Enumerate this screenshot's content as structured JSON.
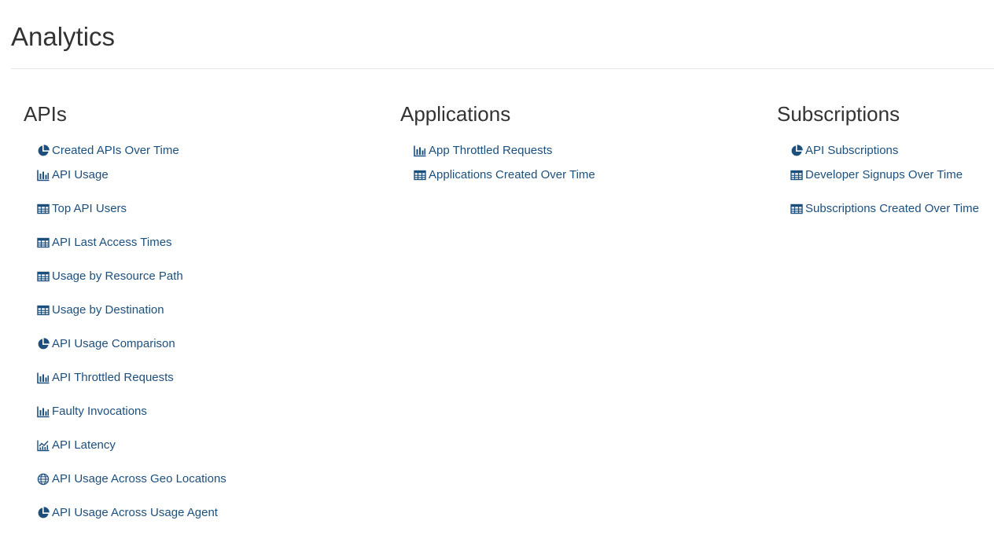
{
  "page": {
    "title": "Analytics"
  },
  "sections": {
    "apis": {
      "heading": "APIs",
      "items": [
        {
          "label": "Created APIs Over Time",
          "icon": "pie-chart-icon"
        },
        {
          "label": "API Usage",
          "icon": "bar-chart-icon"
        },
        {
          "label": "Top API Users",
          "icon": "table-icon"
        },
        {
          "label": "API Last Access Times",
          "icon": "table-icon"
        },
        {
          "label": "Usage by Resource Path",
          "icon": "table-icon"
        },
        {
          "label": "Usage by Destination",
          "icon": "table-icon"
        },
        {
          "label": "API Usage Comparison",
          "icon": "pie-chart-icon"
        },
        {
          "label": "API Throttled Requests",
          "icon": "bar-chart-icon"
        },
        {
          "label": "Faulty Invocations",
          "icon": "bar-chart-icon"
        },
        {
          "label": "API Latency",
          "icon": "line-chart-icon"
        },
        {
          "label": "API Usage Across Geo Locations",
          "icon": "globe-icon"
        },
        {
          "label": "API Usage Across Usage Agent",
          "icon": "pie-chart-icon"
        }
      ]
    },
    "applications": {
      "heading": "Applications",
      "items": [
        {
          "label": "App Throttled Requests",
          "icon": "bar-chart-icon"
        },
        {
          "label": "Applications Created Over Time",
          "icon": "table-icon"
        }
      ]
    },
    "subscriptions": {
      "heading": "Subscriptions",
      "items": [
        {
          "label": "API Subscriptions",
          "icon": "pie-chart-icon"
        },
        {
          "label": "Developer Signups Over Time",
          "icon": "table-icon"
        },
        {
          "label": "Subscriptions Created Over Time",
          "icon": "table-icon"
        }
      ]
    }
  },
  "colors": {
    "link": "#1d4f7c",
    "heading": "#333333",
    "divider": "#e6e6e6"
  }
}
